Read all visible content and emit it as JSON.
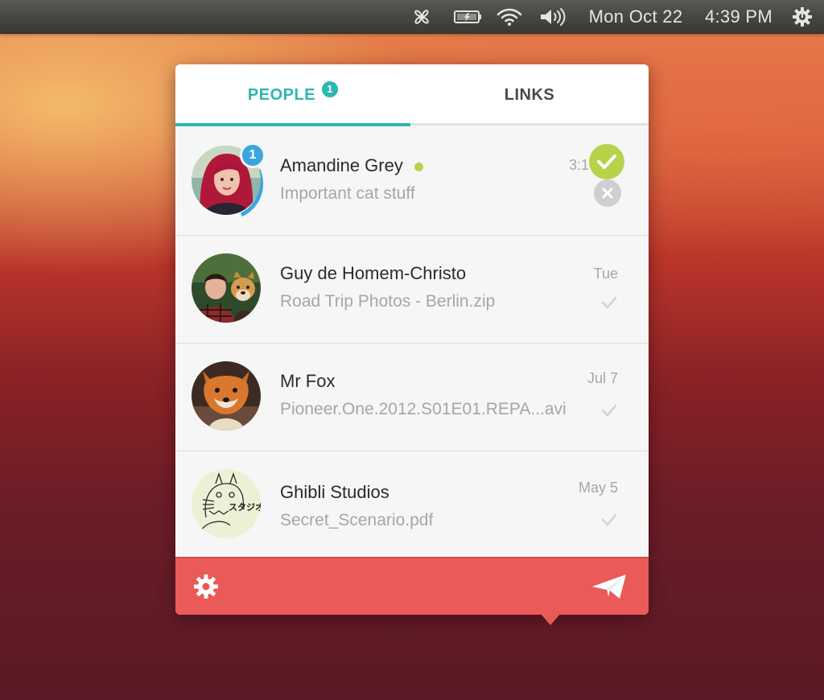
{
  "topbar": {
    "icons": [
      "messaging-icon",
      "battery-icon",
      "wifi-icon",
      "volume-icon",
      "system-gear-icon"
    ],
    "clock_date": "Mon Oct 22",
    "clock_time": "4:39 PM"
  },
  "tabs": {
    "people_label": "PEOPLE",
    "people_badge": "1",
    "links_label": "LINKS",
    "active": "PEOPLE",
    "accent_color": "#2eb6b2"
  },
  "conversations": [
    {
      "name": "Amandine Grey",
      "subtitle": "Important cat stuff",
      "time": "3:1",
      "unread_badge": "1",
      "online": true,
      "actions": [
        "accept-icon",
        "decline-icon"
      ]
    },
    {
      "name": "Guy de Homem-Christo",
      "subtitle": "Road Trip Photos - Berlin.zip",
      "time": "Tue",
      "status_icon": "check-icon"
    },
    {
      "name": "Mr Fox",
      "subtitle": "Pioneer.One.2012.S01E01.REPA...avi",
      "time": "Jul 7",
      "status_icon": "check-icon"
    },
    {
      "name": "Ghibli Studios",
      "subtitle": "Secret_Scenario.pdf",
      "time": "May 5",
      "status_icon": "check-icon",
      "avatar_logo_text": "スタジオ STUDIO"
    }
  ],
  "footer": {
    "left_icon": "settings-gear-icon",
    "right_icon": "send-paper-plane-icon",
    "color": "#e95a59"
  },
  "colors": {
    "online": "#b6d34a",
    "accept": "#b6d34a",
    "badge": "#3aa6e0"
  }
}
